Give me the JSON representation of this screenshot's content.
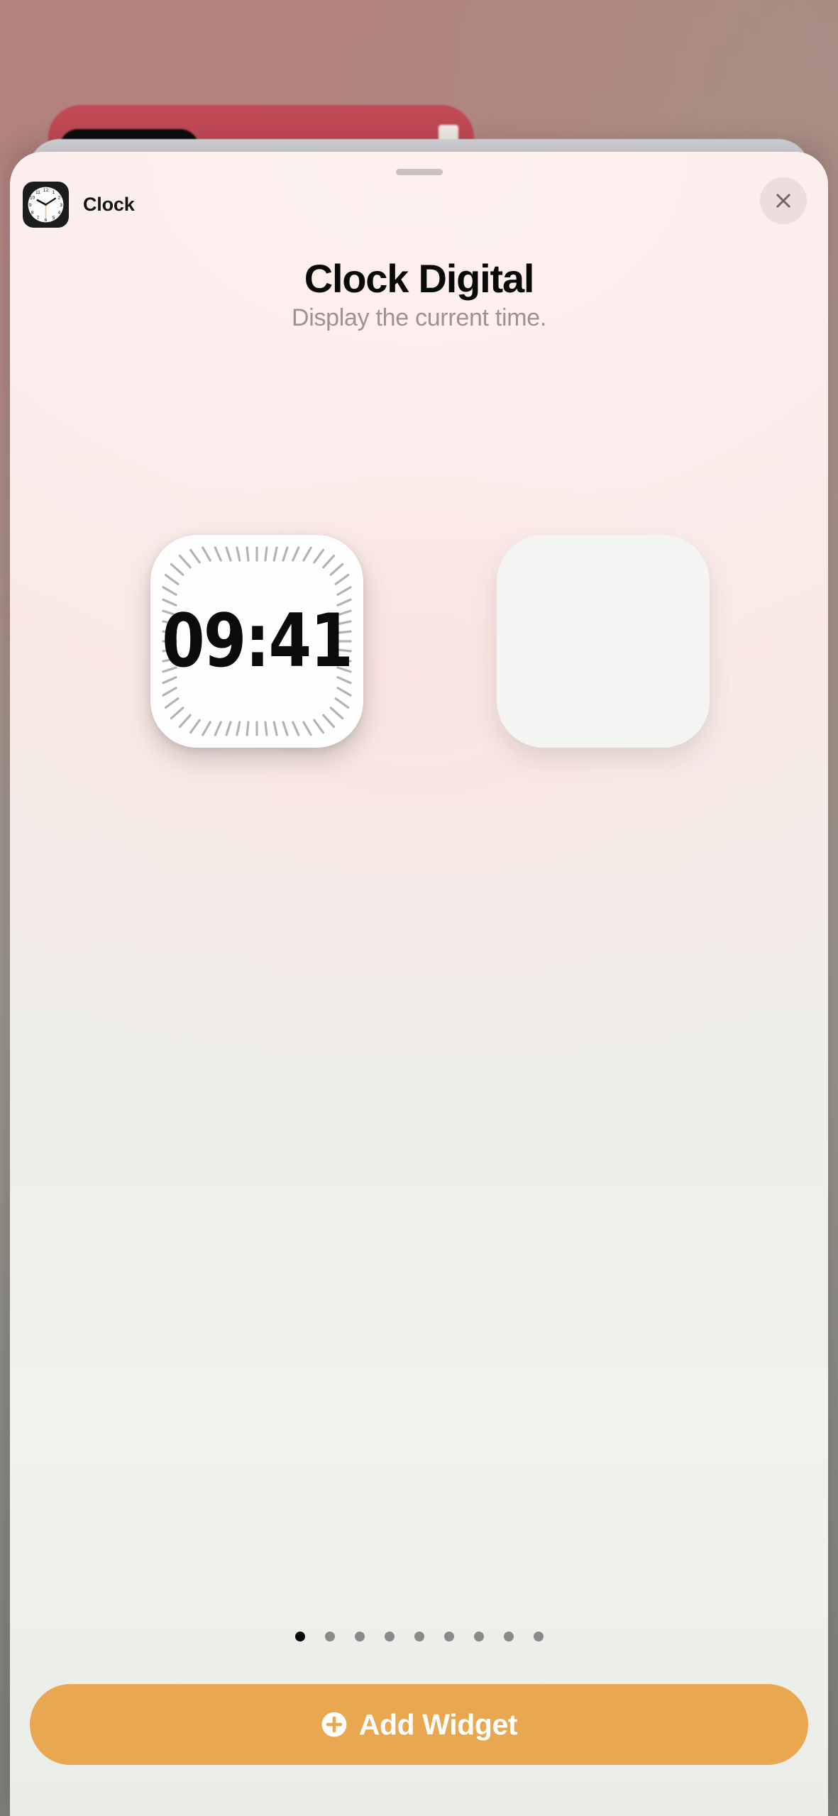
{
  "backdrop": {
    "wallpaper_description": "blurred home screen",
    "peeking_card_color": "#bb4753"
  },
  "sheet": {
    "grabber": "drag-handle",
    "background_top_color": "#fbeeec",
    "background_bottom_color": "#eaece8"
  },
  "header": {
    "app_icon": "clock-icon",
    "app_name": "Clock",
    "close_label": "close-icon"
  },
  "detail": {
    "title": "Clock Digital",
    "subtitle": "Display the current time."
  },
  "widget_preview": {
    "time": "09:41",
    "card_color": "#fefefe",
    "tick_color": "#b3b3b3",
    "tick_count": 60
  },
  "pagination": {
    "total": 9,
    "active_index": 0,
    "active_color": "#0a0a0a",
    "inactive_color": "#8a8a8a"
  },
  "footer": {
    "add_widget_label": "Add Widget",
    "add_widget_icon": "plus-circle-icon",
    "accent_color": "#e8a750"
  }
}
